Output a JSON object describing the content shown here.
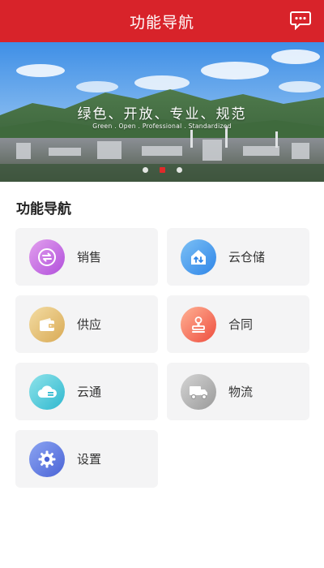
{
  "header": {
    "title": "功能导航",
    "message_icon": "chat-message-icon"
  },
  "banner": {
    "headline": "绿色、开放、专业、规范",
    "subtitle": "Green . Open . Professional . Standardized",
    "slide_count": 3,
    "active_slide": 2
  },
  "section": {
    "title": "功能导航"
  },
  "tiles": [
    {
      "label": "销售",
      "icon": "exchange-icon",
      "color": "#b14fdb"
    },
    {
      "label": "云仓储",
      "icon": "warehouse-icon",
      "color": "#2f86e8"
    },
    {
      "label": "供应",
      "icon": "wallet-icon",
      "color": "#d9aa55"
    },
    {
      "label": "合同",
      "icon": "stamp-icon",
      "color": "#ee4d3e"
    },
    {
      "label": "云通",
      "icon": "cloud-icon",
      "color": "#2fb8cf"
    },
    {
      "label": "物流",
      "icon": "truck-icon",
      "color": "#9a9a9a"
    },
    {
      "label": "设置",
      "icon": "gear-icon",
      "color": "#4a63d6"
    }
  ]
}
